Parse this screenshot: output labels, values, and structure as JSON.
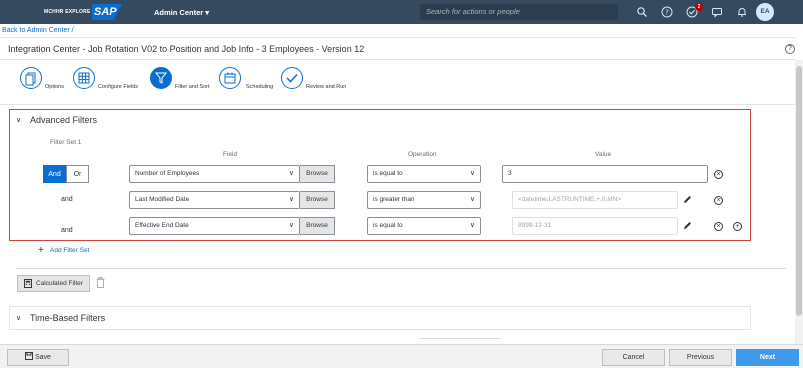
{
  "shell": {
    "brand": "MCHHR EXPLORE",
    "logo": "SAP",
    "module": "Admin Center",
    "search_placeholder": "Search for actions or people",
    "notification_count": "2",
    "avatar": "EA"
  },
  "breadcrumb": {
    "back_link": "Back to Admin Center",
    "separator": "/"
  },
  "page": {
    "title": "Integration Center - Job Rotation V02 to Position and Job Info - 3 Employees - Version 12"
  },
  "wizard": {
    "steps": [
      {
        "label": "Options",
        "icon": "document-icon"
      },
      {
        "label": "Configure Fields",
        "icon": "grid-icon"
      },
      {
        "label": "Filter and Sort",
        "icon": "filter-icon"
      },
      {
        "label": "Scheduling",
        "icon": "calendar-icon"
      },
      {
        "label": "Review and Run",
        "icon": "checkmark-icon"
      }
    ],
    "active_step": 2
  },
  "advanced_filters": {
    "title": "Advanced Filters",
    "filter_set_label": "Filter Set 1",
    "columns": {
      "field": "Field",
      "operation": "Operation",
      "value": "Value"
    },
    "and_label": "And",
    "or_label": "Or",
    "browse_label": "Browse",
    "rows": [
      {
        "conjunction": "",
        "field": "Number of Employees",
        "operation": "is equal to",
        "value": "3"
      },
      {
        "conjunction": "and",
        "field": "Last Modified Date",
        "operation": "is greater than",
        "value": "<datetime,LASTRUNTIME,+,0,MN>"
      },
      {
        "conjunction": "and",
        "field": "Effective End Date",
        "operation": "is equal to",
        "value": "9999-12-31"
      }
    ],
    "add_filter_set": "Add Filter Set",
    "calculated_filter": "Calculated Filter"
  },
  "time_based_filters": {
    "title": "Time-Based Filters"
  },
  "footer": {
    "save": "Save",
    "cancel": "Cancel",
    "previous": "Previous",
    "next": "Next"
  },
  "colors": {
    "shell": "#354a5f",
    "accent": "#0a6ed1",
    "highlight_border": "#d04343",
    "primary_button": "#3f9aec"
  }
}
